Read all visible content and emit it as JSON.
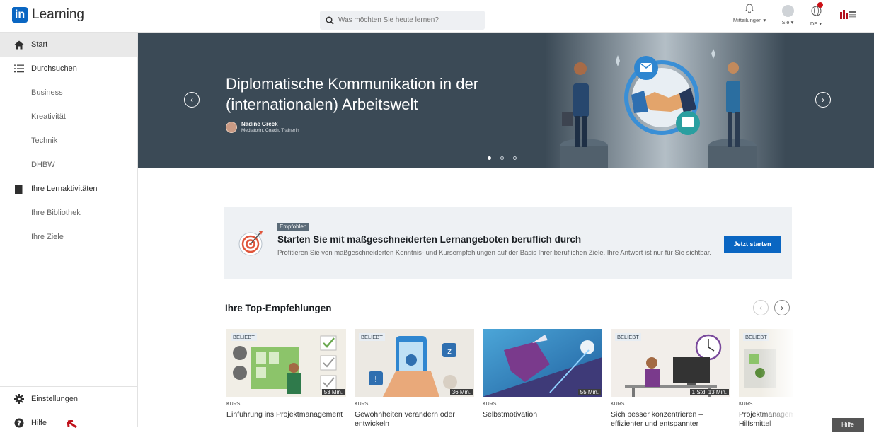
{
  "app": {
    "brand": "Learning",
    "logo_text": "in"
  },
  "search": {
    "placeholder": "Was möchten Sie heute lernen?"
  },
  "topnav": {
    "notifications": "Mitteilungen",
    "me": "Sie",
    "language": "DE"
  },
  "sidebar": {
    "items": [
      {
        "label": "Start",
        "icon": "home-icon"
      },
      {
        "label": "Durchsuchen",
        "icon": "list-icon"
      },
      {
        "label": "Business"
      },
      {
        "label": "Kreativität"
      },
      {
        "label": "Technik"
      },
      {
        "label": "DHBW"
      },
      {
        "label": "Ihre Lernaktivitäten",
        "icon": "library-icon"
      },
      {
        "label": "Ihre Bibliothek"
      },
      {
        "label": "Ihre Ziele"
      }
    ],
    "bottom": [
      {
        "label": "Einstellungen",
        "icon": "gear-icon"
      },
      {
        "label": "Hilfe",
        "icon": "help-icon"
      }
    ]
  },
  "hero": {
    "title": "Diplomatische Kommunikation in der (internationalen) Arbeitswelt",
    "author_name": "Nadine Greck",
    "author_role": "Mediatorin, Coach, Trainerin",
    "slide_index": 1,
    "slide_count": 3
  },
  "recommendation": {
    "badge": "Empfohlen",
    "heading": "Starten Sie mit maßgeschneiderten Lernangeboten beruflich durch",
    "description": "Profitieren Sie von maßgeschneiderten Kenntnis- und Kursempfehlungen auf der Basis Ihrer beruflichen Ziele. Ihre Antwort ist nur für Sie sichtbar.",
    "cta": "Jetzt starten"
  },
  "top_recommendations": {
    "title": "Ihre Top-Empfehlungen",
    "cards": [
      {
        "badge": "BELIEBT",
        "duration": "53 Min.",
        "type": "KURS",
        "title": "Einführung ins Projektmanagement"
      },
      {
        "badge": "BELIEBT",
        "duration": "36 Min.",
        "type": "KURS",
        "title": "Gewohnheiten verändern oder entwickeln"
      },
      {
        "badge": "",
        "duration": "55 Min.",
        "type": "KURS",
        "title": "Selbstmotivation"
      },
      {
        "badge": "BELIEBT",
        "duration": "1 Std. 13 Min.",
        "type": "KURS",
        "title": "Sich besser konzentrieren – effizienter und entspannter"
      },
      {
        "badge": "BELIEBT",
        "duration": "",
        "type": "KURS",
        "title": "Projektmanagement Software, Hilfsmittel"
      }
    ]
  },
  "help_button": "Hilfe",
  "colors": {
    "accent": "#0a66c2",
    "hero_bg": "#3b4a56",
    "reco_bg": "#eef1f4"
  }
}
